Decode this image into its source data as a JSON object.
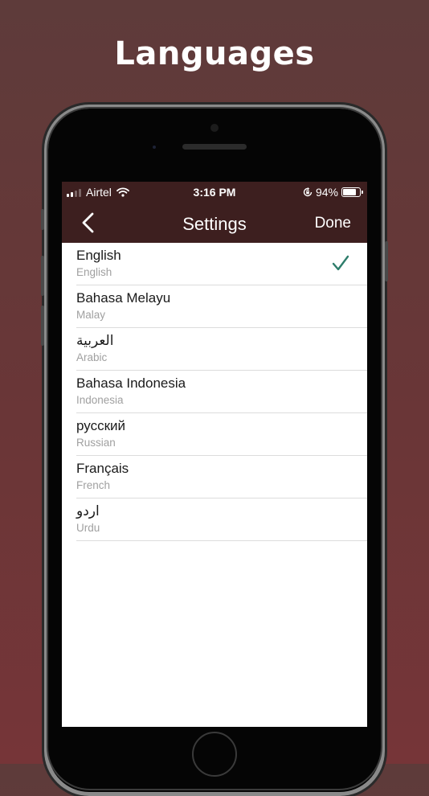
{
  "headline": "Languages",
  "status_bar": {
    "carrier": "Airtel",
    "time": "3:16 PM",
    "battery_percent": "94%",
    "battery_level": 0.94,
    "signal_bars": 2,
    "icons": [
      "signal-icon",
      "wifi-icon",
      "orientation-lock-icon",
      "battery-icon"
    ]
  },
  "nav": {
    "back_icon": "chevron-left-icon",
    "title": "Settings",
    "done_label": "Done"
  },
  "languages": [
    {
      "name": "English",
      "subtitle": "English",
      "selected": true
    },
    {
      "name": "Bahasa Melayu",
      "subtitle": "Malay",
      "selected": false
    },
    {
      "name": "العربية",
      "subtitle": "Arabic",
      "selected": false
    },
    {
      "name": "Bahasa Indonesia",
      "subtitle": "Indonesia",
      "selected": false
    },
    {
      "name": "русский",
      "subtitle": "Russian",
      "selected": false
    },
    {
      "name": "Français",
      "subtitle": "French",
      "selected": false
    },
    {
      "name": "اردو",
      "subtitle": "Urdu",
      "selected": false
    }
  ],
  "colors": {
    "bar_background": "#3d1f1f",
    "checkmark": "#2e7d6b",
    "background_top": "#5e3b3a",
    "background_bottom": "#763538"
  }
}
